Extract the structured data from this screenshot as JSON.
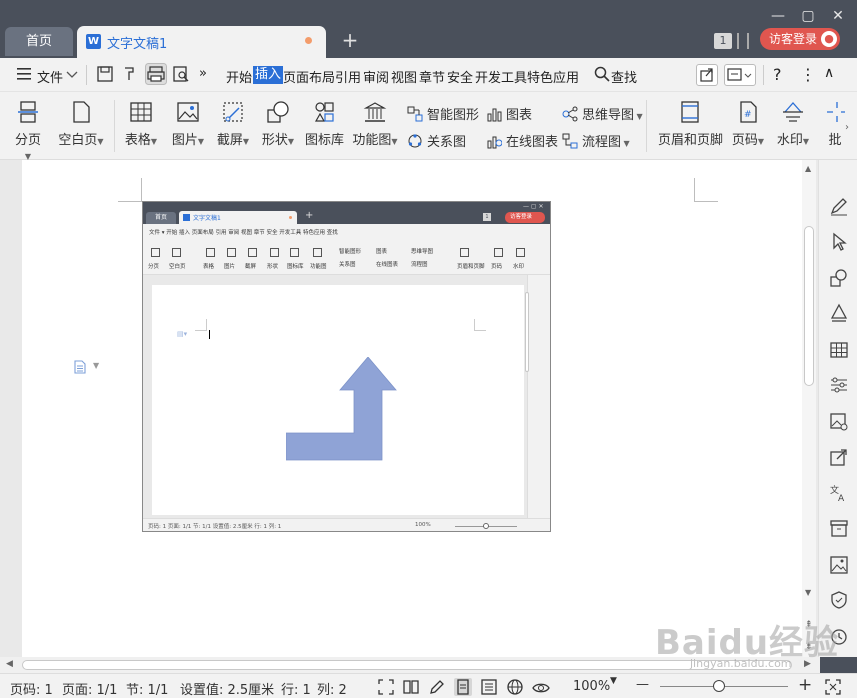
{
  "window": {
    "home_tab": "首页",
    "doc_tab": "文字文稿1",
    "doc_logo": "W",
    "new_tab": "+",
    "page_badge": "1",
    "login": "访客登录",
    "controls": [
      "—",
      "▢",
      "✕"
    ]
  },
  "menubar": {
    "file": "文件",
    "more": "»",
    "items": [
      "开始",
      "插入",
      "页面布局",
      "引用",
      "审阅",
      "视图",
      "章节",
      "安全",
      "开发工具",
      "特色应用"
    ],
    "active_item": "插入",
    "search": "查找",
    "help": "?",
    "more_menu": "⋮",
    "collapse": "∧"
  },
  "ribbon": {
    "big_buttons": [
      {
        "id": "page-break",
        "label": "分页"
      },
      {
        "id": "blank-page",
        "label": "空白页"
      },
      {
        "id": "table",
        "label": "表格"
      },
      {
        "id": "picture",
        "label": "图片"
      },
      {
        "id": "screenshot",
        "label": "截屏"
      },
      {
        "id": "shapes",
        "label": "形状"
      },
      {
        "id": "icon-library",
        "label": "图标库"
      },
      {
        "id": "function-chart",
        "label": "功能图"
      },
      {
        "id": "header-footer",
        "label": "页眉和页脚"
      },
      {
        "id": "page-number",
        "label": "页码"
      },
      {
        "id": "watermark",
        "label": "水印"
      },
      {
        "id": "truncated",
        "label": "批"
      }
    ],
    "small_buttons": [
      {
        "id": "smart-art",
        "label": "智能图形"
      },
      {
        "id": "chart",
        "label": "图表"
      },
      {
        "id": "mind-map",
        "label": "思维导图"
      },
      {
        "id": "relation-chart",
        "label": "关系图"
      },
      {
        "id": "online-chart",
        "label": "在线图表"
      },
      {
        "id": "flowchart",
        "label": "流程图"
      }
    ]
  },
  "embedded": {
    "home_tab": "首页",
    "doc_tab": "文字文稿1",
    "login": "访客登录",
    "page_badge": "1",
    "menu": "文件  ▾   开始 插入 页面布局 引用 审阅 视图 章节 安全 开发工具 特色应用   查找",
    "ribbon_labels": [
      "分页",
      "空白页",
      "表格",
      "图片",
      "截屏",
      "形状",
      "图标库",
      "功能图",
      "智能图形",
      "关系图",
      "图表",
      "在线图表",
      "思维导图",
      "流程图",
      "页眉和页脚",
      "页码",
      "水印"
    ],
    "status": "页码: 1   页面: 1/1   节: 1/1   设置值: 2.5厘米   行: 1   列: 1",
    "zoom": "100%",
    "shape_color": "#8fa3d6"
  },
  "statusbar": {
    "page_no": "页码: 1",
    "pages": "页面: 1/1",
    "section": "节: 1/1",
    "setting": "设置值: 2.5厘米",
    "row": "行: 1",
    "col": "列: 2",
    "zoom": "100%",
    "minus": "—",
    "plus": "+"
  },
  "watermark": {
    "brand": "Baidu经验",
    "url": "jingyan.baidu.com"
  },
  "colors": {
    "accent": "#2b6fd6",
    "login": "#e0564f",
    "titlebar": "#4a505b"
  }
}
